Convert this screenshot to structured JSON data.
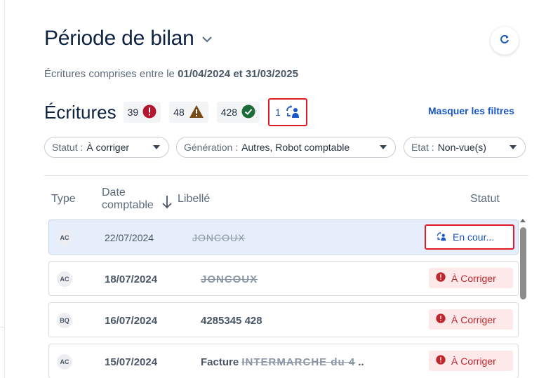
{
  "header": {
    "title": "Période de bilan",
    "subtitle_prefix": "Écritures comprises entre le ",
    "date_start": "01/04/2024",
    "subtitle_and": " et ",
    "date_end": "31/03/2025"
  },
  "ecritures": {
    "title": "Écritures",
    "counts": [
      {
        "value": "39",
        "icon": "error-icon",
        "color": "#b3162e"
      },
      {
        "value": "48",
        "icon": "warning-icon",
        "color": "#7a4a14"
      },
      {
        "value": "428",
        "icon": "check-icon",
        "color": "#1e6b3a"
      },
      {
        "value": "1",
        "icon": "reassign-icon",
        "color": "#1a56c4"
      }
    ],
    "hide_filters": "Masquer les filtres"
  },
  "filters": [
    {
      "label": "Statut :",
      "value": "À corriger"
    },
    {
      "label": "Génération :",
      "value": "Autres, Robot comptable"
    },
    {
      "label": "Etat :",
      "value": "Non-vue(s)"
    }
  ],
  "table": {
    "headers": {
      "type": "Type",
      "date_line1": "Date",
      "date_line2": "comptable",
      "libelle": "Libellé",
      "statut": "Statut"
    },
    "rows": [
      {
        "type": "AC",
        "date": "22/07/2024",
        "libelle": "JONCOUX",
        "libelle_suffix": "",
        "status": "En cour...",
        "status_kind": "encours"
      },
      {
        "type": "AC",
        "date": "18/07/2024",
        "libelle": "JONCOUX",
        "libelle_suffix": "",
        "status": "À Corriger",
        "status_kind": "corriger"
      },
      {
        "type": "BQ",
        "date": "16/07/2024",
        "libelle_plain": "4285345 428",
        "status": "À Corriger",
        "status_kind": "corriger"
      },
      {
        "type": "AC",
        "date": "15/07/2024",
        "libelle_prefix": "Facture ",
        "libelle": "INTERMARCHE du 4",
        "libelle_suffix": " ..",
        "status": "À Corriger",
        "status_kind": "corriger"
      }
    ]
  },
  "colors": {
    "accent": "#1a56c4",
    "title": "#0d2240",
    "error": "#c0272d",
    "highlight_row": "#e6eefc"
  }
}
